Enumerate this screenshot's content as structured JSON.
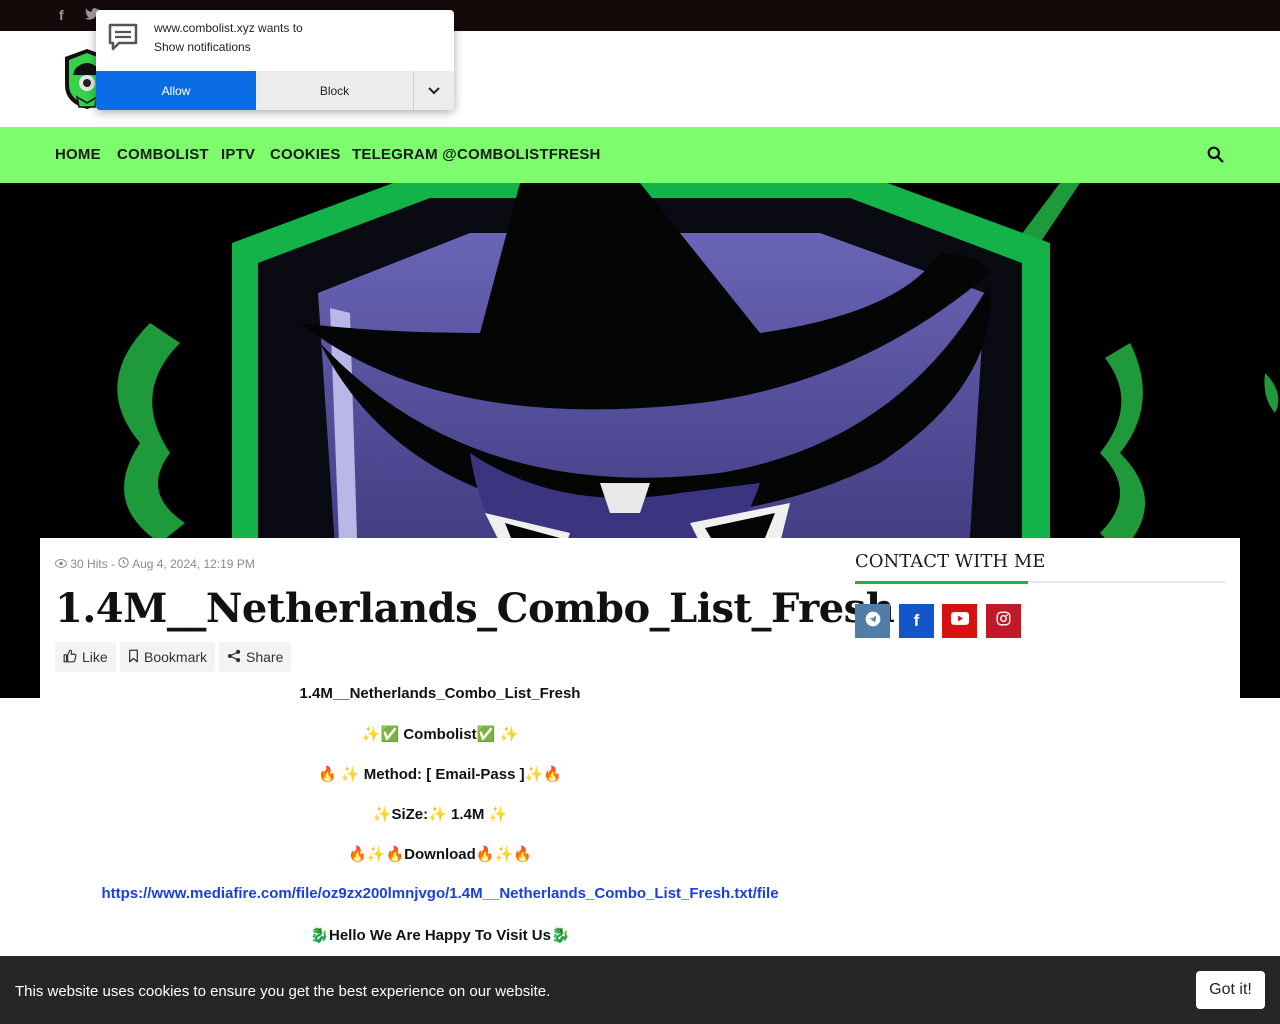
{
  "notification": {
    "line1": "www.combolist.xyz wants to",
    "line2": "Show notifications",
    "allow_label": "Allow",
    "block_label": "Block"
  },
  "nav": {
    "items": [
      "HOME",
      "COMBOLIST",
      "IPTV",
      "COOKIES",
      "TELEGRAM @COMBOLISTFRESH"
    ]
  },
  "post": {
    "hits": "30 Hits",
    "separator": "-",
    "date": "Aug 4, 2024, 12:19 PM",
    "title": "1.4M__Netherlands_Combo_List_Fresh",
    "like_label": "Like",
    "bookmark_label": "Bookmark",
    "share_label": "Share",
    "body": {
      "heading": "1.4M__Netherlands_Combo_List_Fresh",
      "line_combolist": "✨✅ Combolist✅ ✨",
      "line_method": "🔥 ✨ Method: [ Email-Pass ]✨🔥",
      "line_size": "✨SiZe:✨ 1.4M ✨",
      "line_download": "🔥✨🔥Download🔥✨🔥",
      "link": "https://www.mediafire.com/file/oz9zx200lmnjvgo/1.4M__Netherlands_Combo_List_Fresh.txt/file",
      "line_hello": "🐉Hello We Are Happy To Visit Us🐉"
    }
  },
  "sidebar": {
    "title": "CONTACT WITH ME"
  },
  "cookie": {
    "message": "This website uses cookies to ensure you get the best experience on our website.",
    "button": "Got it!"
  },
  "colors": {
    "nav_bg": "#7dfc6e",
    "accent_green": "#25b13b",
    "link_blue": "#1a3fe0",
    "allow_blue": "#0b6de5",
    "telegram": "#4f7fa6",
    "facebook": "#1256c9",
    "youtube": "#d41212",
    "instagram": "#c01a2a"
  },
  "icons": [
    "facebook-icon",
    "twitter-icon",
    "search-icon",
    "eye-icon",
    "clock-icon",
    "thumbs-up-icon",
    "bookmark-icon",
    "share-icon",
    "telegram-icon",
    "youtube-icon",
    "instagram-icon",
    "chat-bubble-icon",
    "chevron-down-icon"
  ]
}
